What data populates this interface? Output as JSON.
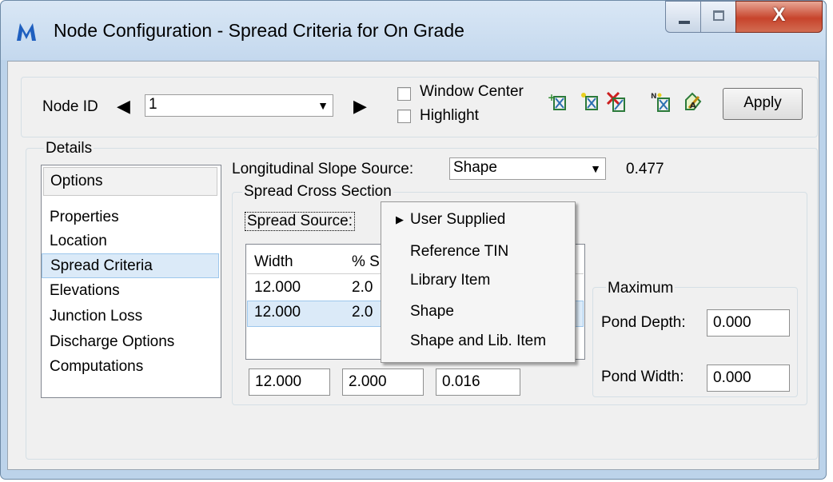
{
  "window": {
    "title": "Node Configuration - Spread Criteria for On Grade",
    "app_icon": "app-logo-icon",
    "close_glyph": "X"
  },
  "node": {
    "label": "Node ID",
    "prev_arrow": "◀",
    "next_arrow": "▶",
    "value": "1",
    "window_center_label": "Window Center",
    "highlight_label": "Highlight",
    "apply_label": "Apply",
    "tools": [
      "add-node-icon",
      "new-node-icon",
      "delete-node-icon",
      "numbered-node-icon",
      "edit-node-icon"
    ]
  },
  "details": {
    "legend": "Details",
    "options_header": "Options",
    "options": [
      "Properties",
      "Location",
      "Spread Criteria",
      "Elevations",
      "Junction Loss",
      "Discharge Options",
      "Computations"
    ],
    "selected_option": "Spread Criteria"
  },
  "slope": {
    "label": "Longitudinal Slope Source:",
    "value": "Shape",
    "readout": "0.477"
  },
  "cross_section": {
    "legend": "Spread Cross Section",
    "spread_source_label": "Spread Source:",
    "table": {
      "headers": [
        "Width",
        "% S"
      ],
      "rows": [
        [
          "12.000",
          "2.0"
        ],
        [
          "12.000",
          "2.0"
        ]
      ]
    },
    "inputs": [
      "12.000",
      "2.000",
      "0.016"
    ]
  },
  "maximum": {
    "legend": "Maximum",
    "pond_depth_label": "Pond Depth:",
    "pond_depth_value": "0.000",
    "pond_width_label": "Pond Width:",
    "pond_width_value": "0.000"
  },
  "source_menu": {
    "items": [
      "User Supplied",
      "Reference TIN",
      "Library Item",
      "Shape",
      "Shape and Lib. Item"
    ],
    "checked_item": "User Supplied",
    "check_glyph": "▶"
  },
  "colors": {
    "title_bar": "#c4d8ee",
    "close_button": "#c7442c",
    "selection": "#dbeaf8"
  }
}
